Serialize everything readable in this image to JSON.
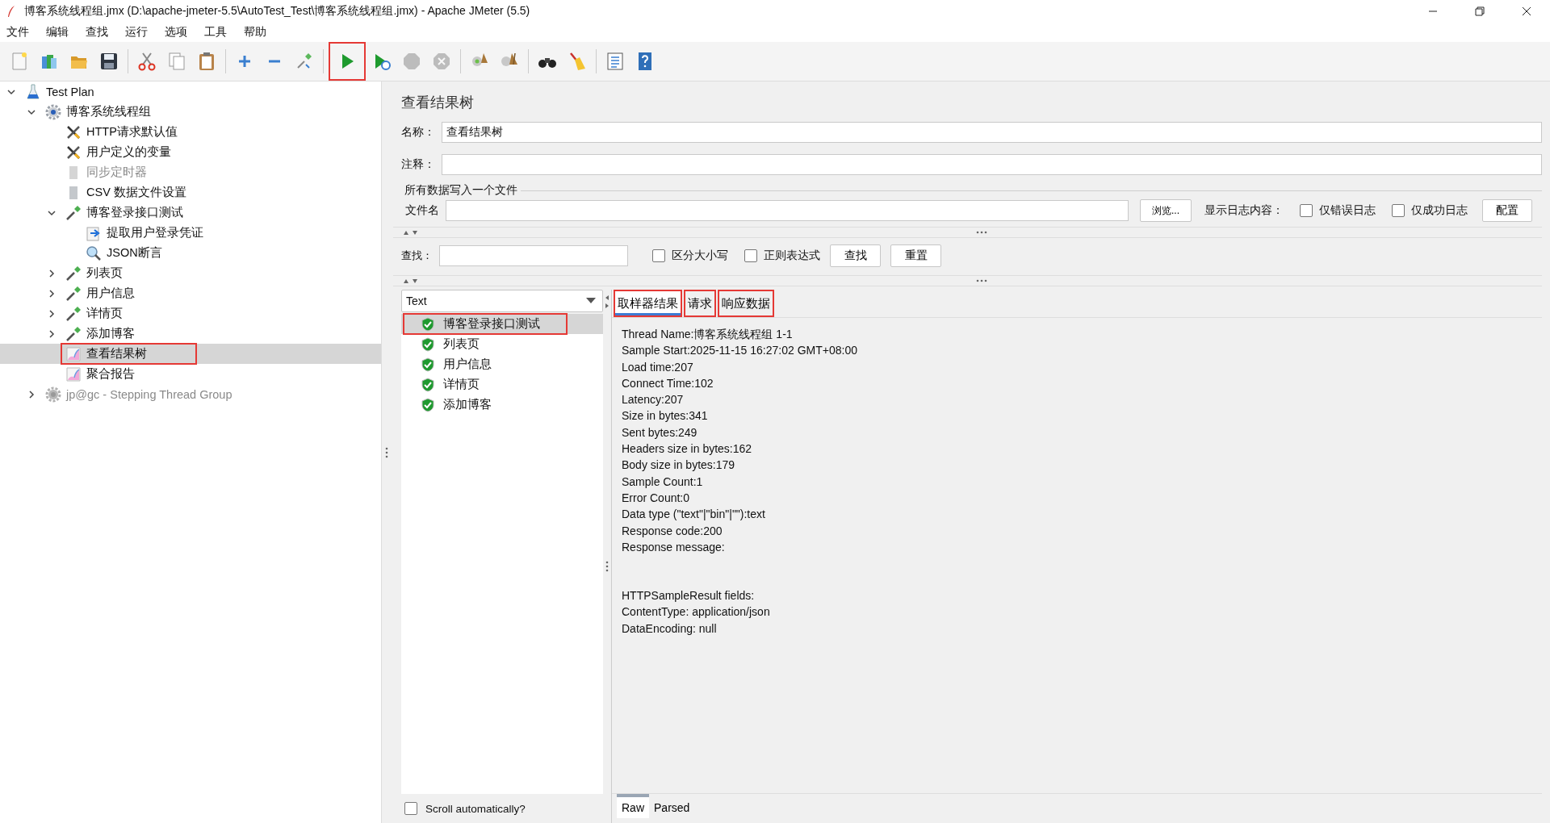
{
  "window": {
    "title": "博客系统线程组.jmx (D:\\apache-jmeter-5.5\\AutoTest_Test\\博客系统线程组.jmx) - Apache JMeter (5.5)"
  },
  "menu": [
    "文件",
    "编辑",
    "查找",
    "运行",
    "选项",
    "工具",
    "帮助"
  ],
  "toolbar": [
    [
      {
        "kind": "new",
        "highlighted": false,
        "disabled": false
      },
      {
        "kind": "templates",
        "highlighted": false,
        "disabled": false
      },
      {
        "kind": "open",
        "highlighted": false,
        "disabled": false
      },
      {
        "kind": "save",
        "highlighted": false,
        "disabled": false
      }
    ],
    [
      {
        "kind": "cut",
        "highlighted": false,
        "disabled": false
      },
      {
        "kind": "copy",
        "highlighted": false,
        "disabled": false
      },
      {
        "kind": "paste",
        "highlighted": false,
        "disabled": false
      }
    ],
    [
      {
        "kind": "expand",
        "highlighted": false,
        "disabled": false
      },
      {
        "kind": "collapse",
        "highlighted": false,
        "disabled": false
      },
      {
        "kind": "toggle",
        "highlighted": false,
        "disabled": false
      }
    ],
    [
      {
        "kind": "start",
        "highlighted": true,
        "disabled": false
      },
      {
        "kind": "start-no-timers",
        "highlighted": false,
        "disabled": false
      },
      {
        "kind": "stop",
        "highlighted": false,
        "disabled": true
      },
      {
        "kind": "shutdown",
        "highlighted": false,
        "disabled": true
      }
    ],
    [
      {
        "kind": "clear",
        "highlighted": false,
        "disabled": false
      },
      {
        "kind": "clear-all",
        "highlighted": false,
        "disabled": false
      }
    ],
    [
      {
        "kind": "search",
        "highlighted": false,
        "disabled": false
      },
      {
        "kind": "reset",
        "highlighted": false,
        "disabled": false
      }
    ],
    [
      {
        "kind": "functions",
        "highlighted": false,
        "disabled": false
      },
      {
        "kind": "help",
        "highlighted": false,
        "disabled": false
      }
    ]
  ],
  "tree": [
    {
      "label": "Test Plan",
      "kind": "plan",
      "expanded": true,
      "selected": false,
      "disabled": false,
      "highlighted": false,
      "children": [
        {
          "label": "博客系统线程组",
          "kind": "threadgroup",
          "expanded": true,
          "selected": false,
          "disabled": false,
          "highlighted": false,
          "children": [
            {
              "label": "HTTP请求默认值",
              "kind": "config",
              "selected": false,
              "disabled": false,
              "highlighted": false
            },
            {
              "label": "用户定义的变量",
              "kind": "config",
              "selected": false,
              "disabled": false,
              "highlighted": false
            },
            {
              "label": "同步定时器",
              "kind": "page",
              "selected": false,
              "disabled": true,
              "highlighted": false
            },
            {
              "label": "CSV 数据文件设置",
              "kind": "page",
              "selected": false,
              "disabled": false,
              "highlighted": false
            },
            {
              "label": "博客登录接口测试",
              "kind": "sampler",
              "expanded": true,
              "selected": false,
              "disabled": false,
              "highlighted": false,
              "children": [
                {
                  "label": "提取用户登录凭证",
                  "kind": "extractor",
                  "selected": false,
                  "disabled": false,
                  "highlighted": false
                },
                {
                  "label": "JSON断言",
                  "kind": "assertion",
                  "selected": false,
                  "disabled": false,
                  "highlighted": false
                }
              ]
            },
            {
              "label": "列表页",
              "kind": "sampler",
              "expanded": false,
              "selected": false,
              "disabled": false,
              "highlighted": false
            },
            {
              "label": "用户信息",
              "kind": "sampler",
              "expanded": false,
              "selected": false,
              "disabled": false,
              "highlighted": false
            },
            {
              "label": "详情页",
              "kind": "sampler",
              "expanded": false,
              "selected": false,
              "disabled": false,
              "highlighted": false
            },
            {
              "label": "添加博客",
              "kind": "sampler",
              "expanded": false,
              "selected": false,
              "disabled": false,
              "highlighted": false
            },
            {
              "label": "查看结果树",
              "kind": "listener",
              "selected": true,
              "disabled": false,
              "highlighted": true
            },
            {
              "label": "聚合报告",
              "kind": "listener",
              "selected": false,
              "disabled": false,
              "highlighted": false
            }
          ]
        },
        {
          "label": "jp@gc - Stepping Thread Group",
          "kind": "threadgroup",
          "expanded": false,
          "selected": false,
          "disabled": true,
          "highlighted": false
        }
      ]
    }
  ],
  "panel": {
    "title": "查看结果树",
    "name_label": "名称：",
    "name_value": "查看结果树",
    "comment_label": "注释：",
    "file_group": "所有数据写入一个文件",
    "file_label": "文件名",
    "browse_button": "浏览...",
    "log_label": "显示日志内容：",
    "log_options": [
      {
        "label": "仅错误日志",
        "checked": false
      },
      {
        "label": "仅成功日志",
        "checked": false
      }
    ],
    "config_button": "配置"
  },
  "search": {
    "label": "查找：",
    "options": [
      {
        "label": "区分大小写",
        "checked": false
      },
      {
        "label": "正则表达式",
        "checked": false
      }
    ],
    "buttons": [
      "查找",
      "重置"
    ]
  },
  "results": {
    "renderer": "Text",
    "items": [
      {
        "label": "博客登录接口测试",
        "success": true,
        "selected": true,
        "highlighted": true
      },
      {
        "label": "列表页",
        "success": true,
        "selected": false,
        "highlighted": false
      },
      {
        "label": "用户信息",
        "success": true,
        "selected": false,
        "highlighted": false
      },
      {
        "label": "详情页",
        "success": true,
        "selected": false,
        "highlighted": false
      },
      {
        "label": "添加博客",
        "success": true,
        "selected": false,
        "highlighted": false
      }
    ],
    "scroll_auto": {
      "label": "Scroll automatically?",
      "checked": false
    }
  },
  "tabs": [
    {
      "label": "取样器结果",
      "selected": true,
      "highlighted": true
    },
    {
      "label": "请求",
      "selected": false,
      "highlighted": true
    },
    {
      "label": "响应数据",
      "selected": false,
      "highlighted": true
    }
  ],
  "details": [
    [
      "Thread Name:博客系统线程组 1-1",
      "Sample Start:2025-11-15 16:27:02 GMT+08:00",
      "Load time:207",
      "Connect Time:102",
      "Latency:207",
      "Size in bytes:341",
      "Sent bytes:249",
      "Headers size in bytes:162",
      "Body size in bytes:179",
      "Sample Count:1",
      "Error Count:0",
      "Data type (\"text\"|\"bin\"|\"\"):text",
      "Response code:200",
      "Response message:"
    ],
    [
      "HTTPSampleResult fields:",
      "ContentType: application/json",
      "DataEncoding: null"
    ]
  ],
  "view_tabs": [
    {
      "label": "Raw",
      "selected": true
    },
    {
      "label": "Parsed",
      "selected": false
    }
  ]
}
